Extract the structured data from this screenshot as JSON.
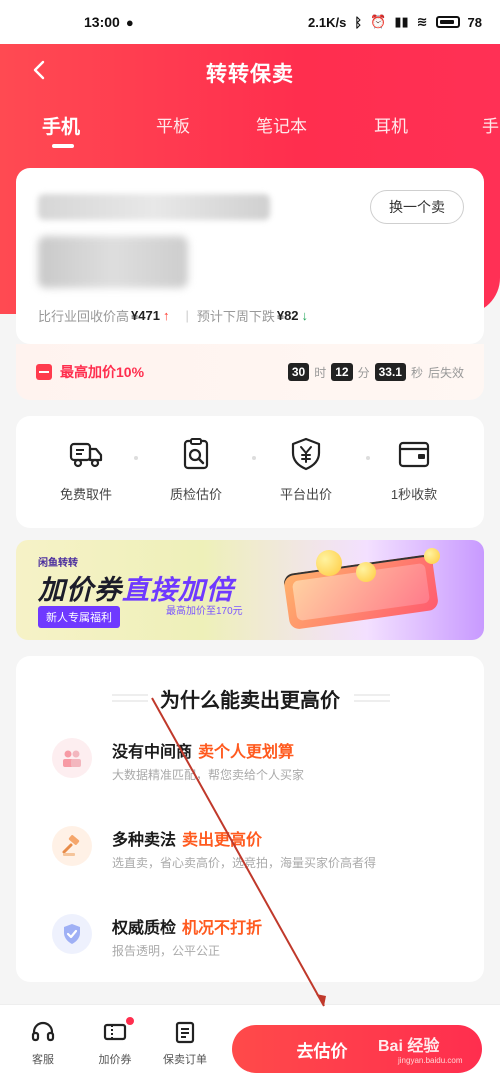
{
  "status_bar": {
    "time": "13:00",
    "network_speed": "2.1K/s",
    "battery_text": "78"
  },
  "header": {
    "title": "转转保卖",
    "back_icon": "chevron-left-icon"
  },
  "tabs": [
    {
      "label": "手机",
      "active": true
    },
    {
      "label": "平板",
      "active": false
    },
    {
      "label": "笔记本",
      "active": false
    },
    {
      "label": "耳机",
      "active": false
    },
    {
      "label": "手",
      "active": false
    }
  ],
  "device_card": {
    "switch_label": "换一个卖",
    "compare_label": "比行业回收价高",
    "compare_value": "¥471",
    "forecast_label": "预计下周下跌",
    "forecast_value": "¥82"
  },
  "promo": {
    "text": "最高加价10%",
    "hours": "30",
    "hours_unit": "时",
    "minutes": "12",
    "minutes_unit": "分",
    "seconds": "33.1",
    "seconds_unit": "秒",
    "expire_text": "后失效"
  },
  "services": [
    {
      "label": "免费取件",
      "icon": "truck-icon"
    },
    {
      "label": "质检估价",
      "icon": "inspect-icon"
    },
    {
      "label": "平台出价",
      "icon": "shield-yen-icon"
    },
    {
      "label": "1秒收款",
      "icon": "wallet-icon"
    }
  ],
  "banner": {
    "small_text": "闲鱼转转",
    "main_text_a": "加价券",
    "main_text_b": "直接加倍",
    "sub_text": "最高加价至170元",
    "tag": "新人专属福利"
  },
  "why_section": {
    "title": "为什么能卖出更高价",
    "reasons": [
      {
        "title": "没有中间商",
        "highlight": "卖个人更划算",
        "desc": "大数据精准匹配，帮您卖给个人买家",
        "icon": "people-icon"
      },
      {
        "title": "多种卖法",
        "highlight": "卖出更高价",
        "desc": "选直卖，省心卖高价，选竞拍，海量买家价高者得",
        "icon": "gavel-icon"
      },
      {
        "title": "权威质检",
        "highlight": "机况不打折",
        "desc": "报告透明，公平公正",
        "icon": "shield-check-icon"
      }
    ]
  },
  "bottom_bar": {
    "items": [
      {
        "label": "客服",
        "icon": "headset-icon"
      },
      {
        "label": "加价券",
        "icon": "coupon-icon"
      },
      {
        "label": "保卖订单",
        "icon": "order-icon"
      }
    ],
    "primary_button": "去估价"
  },
  "watermark": {
    "text": "Bai 经验",
    "url": "jingyan.baidu.com"
  },
  "colors": {
    "brand_red": "#ff2e4e",
    "highlight_orange": "#ff5a1f",
    "banner_purple": "#6f39ff"
  }
}
